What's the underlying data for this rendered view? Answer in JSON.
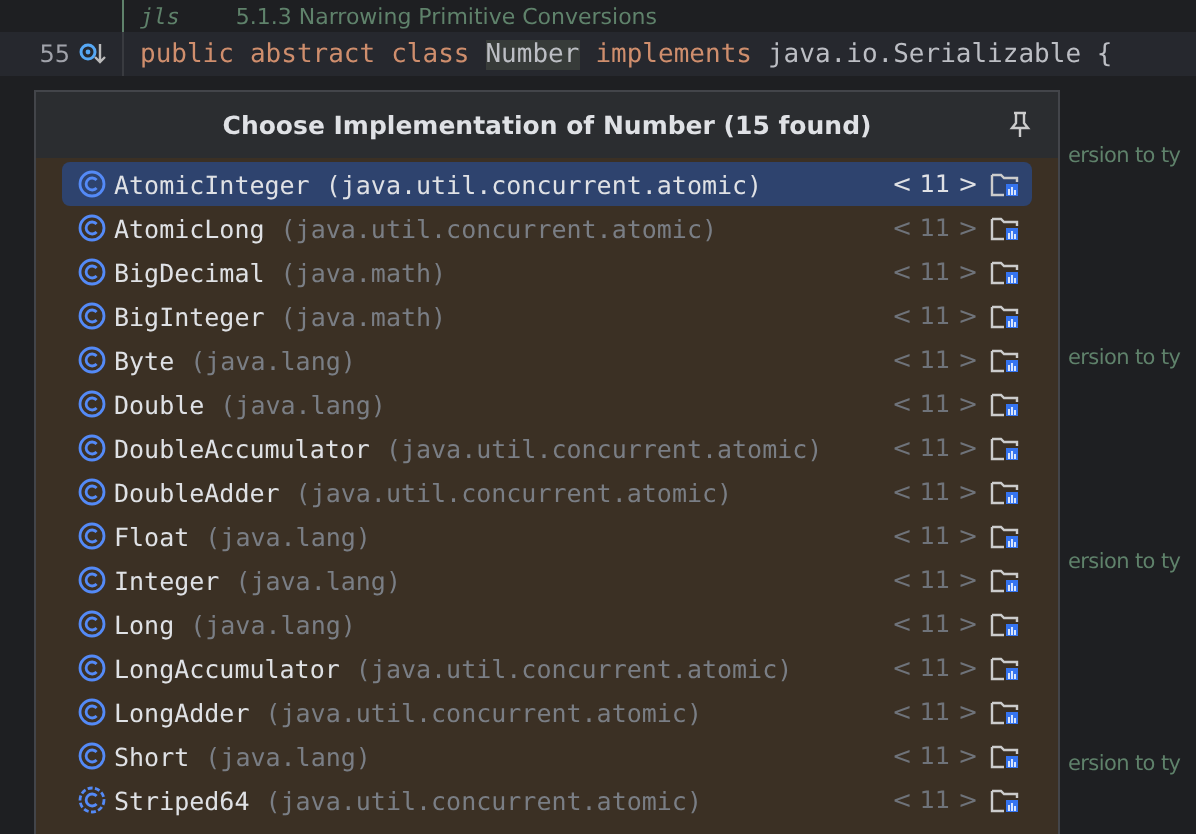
{
  "editor": {
    "top_line": {
      "tag": "jls",
      "text": "5.1.3 Narrowing Primitive Conversions"
    },
    "line_number": "55",
    "code_tokens": [
      {
        "kind": "keyword",
        "text": "public"
      },
      {
        "kind": "keyword",
        "text": "abstract"
      },
      {
        "kind": "keyword",
        "text": "class"
      },
      {
        "kind": "highlight",
        "text": "Number"
      },
      {
        "kind": "keyword",
        "text": "implements"
      },
      {
        "kind": "plain",
        "text": "java.io.Serializable {"
      }
    ],
    "comment_fragments": [
      "ersion to ty",
      "ersion to ty",
      "ersion to ty",
      "ersion to ty"
    ]
  },
  "popup": {
    "title": "Choose Implementation of Number (15 found)",
    "items": [
      {
        "name": "AtomicInteger",
        "package": "(java.util.concurrent.atomic)",
        "version": "< 11 >",
        "selected": true,
        "kind": "class"
      },
      {
        "name": "AtomicLong",
        "package": "(java.util.concurrent.atomic)",
        "version": "< 11 >",
        "selected": false,
        "kind": "class"
      },
      {
        "name": "BigDecimal",
        "package": "(java.math)",
        "version": "< 11 >",
        "selected": false,
        "kind": "class"
      },
      {
        "name": "BigInteger",
        "package": "(java.math)",
        "version": "< 11 >",
        "selected": false,
        "kind": "class"
      },
      {
        "name": "Byte",
        "package": "(java.lang)",
        "version": "< 11 >",
        "selected": false,
        "kind": "class"
      },
      {
        "name": "Double",
        "package": "(java.lang)",
        "version": "< 11 >",
        "selected": false,
        "kind": "class"
      },
      {
        "name": "DoubleAccumulator",
        "package": "(java.util.concurrent.atomic)",
        "version": "< 11 >",
        "selected": false,
        "kind": "class"
      },
      {
        "name": "DoubleAdder",
        "package": "(java.util.concurrent.atomic)",
        "version": "< 11 >",
        "selected": false,
        "kind": "class"
      },
      {
        "name": "Float",
        "package": "(java.lang)",
        "version": "< 11 >",
        "selected": false,
        "kind": "class"
      },
      {
        "name": "Integer",
        "package": "(java.lang)",
        "version": "< 11 >",
        "selected": false,
        "kind": "class"
      },
      {
        "name": "Long",
        "package": "(java.lang)",
        "version": "< 11 >",
        "selected": false,
        "kind": "class"
      },
      {
        "name": "LongAccumulator",
        "package": "(java.util.concurrent.atomic)",
        "version": "< 11 >",
        "selected": false,
        "kind": "class"
      },
      {
        "name": "LongAdder",
        "package": "(java.util.concurrent.atomic)",
        "version": "< 11 >",
        "selected": false,
        "kind": "class"
      },
      {
        "name": "Short",
        "package": "(java.lang)",
        "version": "< 11 >",
        "selected": false,
        "kind": "class"
      },
      {
        "name": "Striped64",
        "package": "(java.util.concurrent.atomic)",
        "version": "< 11 >",
        "selected": false,
        "kind": "abstract"
      }
    ]
  }
}
